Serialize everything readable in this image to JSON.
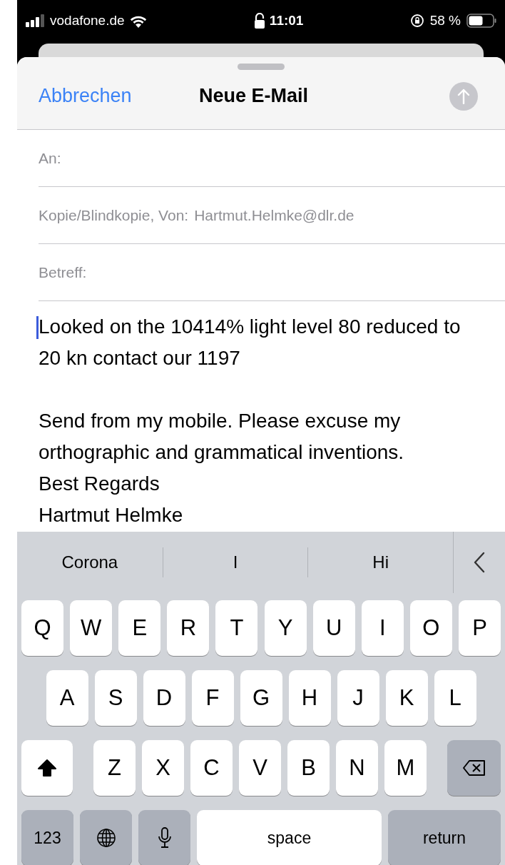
{
  "status_bar": {
    "carrier": "vodafone.de",
    "time": "11:01",
    "battery": "58 %"
  },
  "header": {
    "cancel": "Abbrechen",
    "title": "Neue E-Mail"
  },
  "fields": [
    {
      "label": "An:"
    },
    {
      "label": "Kopie/Blindkopie, Von:",
      "value": "Hartmut.Helmke@dlr.de"
    },
    {
      "label": "Betreff:"
    }
  ],
  "body": {
    "paragraphs": [
      "Looked on the 10414% light level 80 reduced to 20 kn contact our 1197",
      "Send from my mobile. Please excuse my orthographic and grammatical inventions.\nBest Regards\nHartmut Helmke"
    ]
  },
  "keyboard": {
    "suggestions": [
      "Corona",
      "I",
      "Hi"
    ],
    "rows": [
      [
        {
          "kind": "letter",
          "label": "Q"
        },
        {
          "kind": "letter",
          "label": "W"
        },
        {
          "kind": "letter",
          "label": "E"
        },
        {
          "kind": "letter",
          "label": "R"
        },
        {
          "kind": "letter",
          "label": "T"
        },
        {
          "kind": "letter",
          "label": "Y"
        },
        {
          "kind": "letter",
          "label": "U"
        },
        {
          "kind": "letter",
          "label": "I"
        },
        {
          "kind": "letter",
          "label": "O"
        },
        {
          "kind": "letter",
          "label": "P"
        }
      ],
      [
        {
          "kind": "letter",
          "label": "A"
        },
        {
          "kind": "letter",
          "label": "S"
        },
        {
          "kind": "letter",
          "label": "D"
        },
        {
          "kind": "letter",
          "label": "F"
        },
        {
          "kind": "letter",
          "label": "G"
        },
        {
          "kind": "letter",
          "label": "H"
        },
        {
          "kind": "letter",
          "label": "J"
        },
        {
          "kind": "letter",
          "label": "K"
        },
        {
          "kind": "letter",
          "label": "L"
        }
      ],
      [
        {
          "kind": "shift",
          "on": true
        },
        {
          "kind": "letter",
          "label": "Z"
        },
        {
          "kind": "letter",
          "label": "X"
        },
        {
          "kind": "letter",
          "label": "C"
        },
        {
          "kind": "letter",
          "label": "V"
        },
        {
          "kind": "letter",
          "label": "B"
        },
        {
          "kind": "letter",
          "label": "N"
        },
        {
          "kind": "letter",
          "label": "M"
        },
        {
          "kind": "delete"
        }
      ]
    ],
    "bottom_row": [
      {
        "kind": "numbers",
        "label": "123"
      },
      {
        "kind": "globe"
      },
      {
        "kind": "mic"
      },
      {
        "kind": "space",
        "label": "space"
      },
      {
        "kind": "return",
        "label": "return"
      }
    ]
  }
}
